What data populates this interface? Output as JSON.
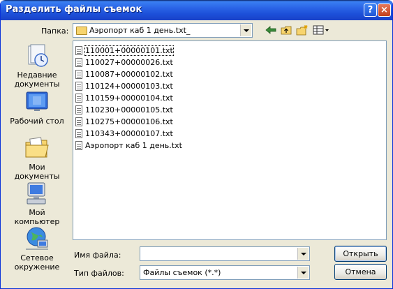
{
  "window": {
    "title": "Разделить файлы съемок"
  },
  "titlebar_buttons": {
    "help": "?",
    "close": "×"
  },
  "lookin": {
    "label": "Папка:",
    "value": "Аэропорт каб 1 день.txt_"
  },
  "places": [
    {
      "label": "Недавние документы",
      "icon": "recent-documents-icon"
    },
    {
      "label": "Рабочий стол",
      "icon": "desktop-icon"
    },
    {
      "label": "Мои документы",
      "icon": "my-documents-icon"
    },
    {
      "label": "Мой компьютер",
      "icon": "my-computer-icon"
    },
    {
      "label": "Сетевое окружение",
      "icon": "network-icon"
    }
  ],
  "files": [
    "110001+00000101.txt",
    "110027+00000026.txt",
    "110087+00000102.txt",
    "110124+00000103.txt",
    "110159+00000104.txt",
    "110230+00000105.txt",
    "110275+00000106.txt",
    "110343+00000107.txt",
    "Аэропорт каб 1 день.txt"
  ],
  "filename": {
    "label": "Имя файла:",
    "value": ""
  },
  "filetype": {
    "label": "Тип файлов:",
    "value": "Файлы съемок (*.*)"
  },
  "buttons": {
    "open": "Открыть",
    "cancel": "Отмена"
  },
  "colors": {
    "titlebar": "#2A63E6",
    "dialog_bg": "#ECE9D8",
    "field_border": "#7F9DB9"
  }
}
